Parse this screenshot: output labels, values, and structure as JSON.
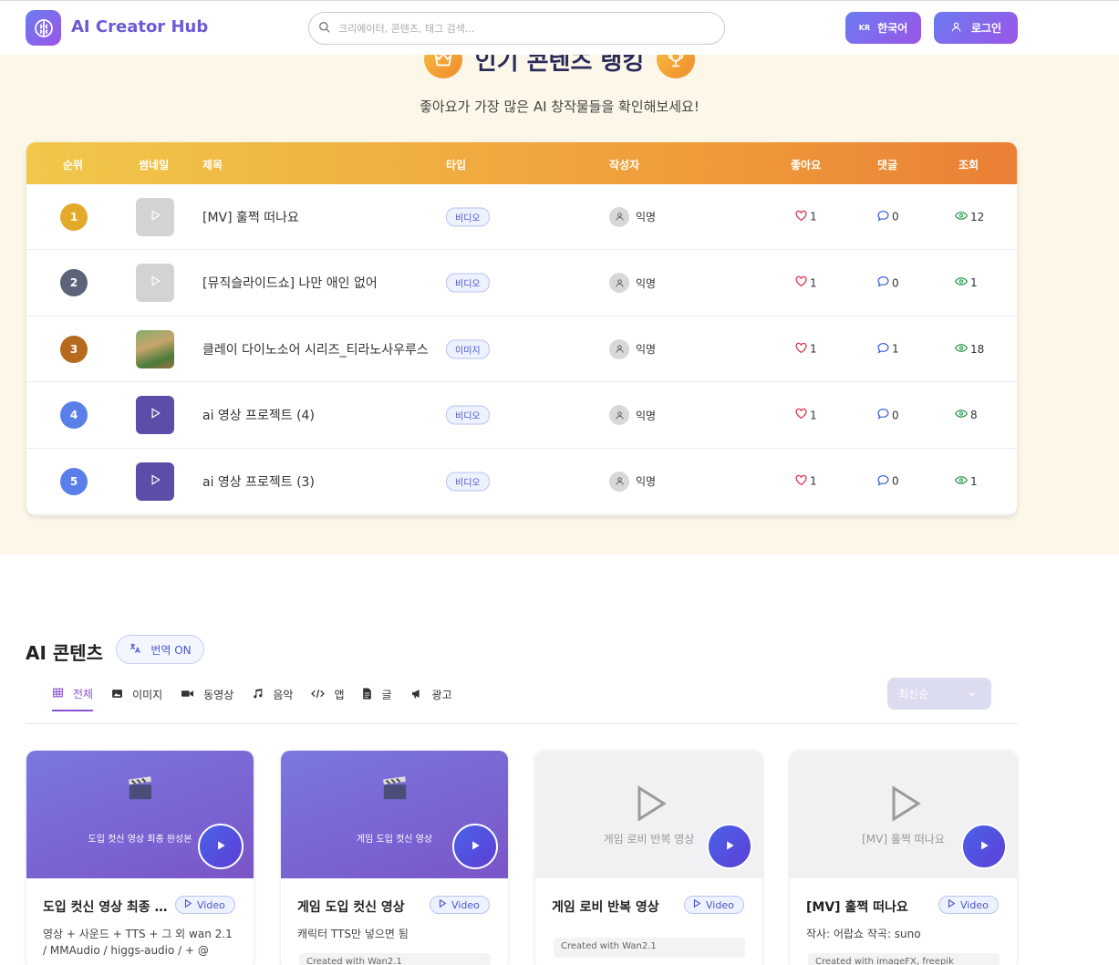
{
  "header": {
    "app_title": "AI Creator Hub",
    "search_placeholder": "크리에이터, 콘텐츠, 태그 검색...",
    "lang_code": "KR",
    "lang_label": "한국어",
    "login_label": "로그인"
  },
  "ranking": {
    "title": "인기 콘텐츠 랭킹",
    "subtitle": "좋아요가 가장 많은 AI 창작물들을 확인해보세요!",
    "columns": [
      "순위",
      "썸네일",
      "제목",
      "타입",
      "작성자",
      "좋아요",
      "댓글",
      "조회"
    ],
    "rows": [
      {
        "rank": "1",
        "badge_color": "#e3a92a",
        "thumb": "gray",
        "title": "[MV] 훌쩍 떠나요",
        "type": "비디오",
        "author": "익명",
        "likes": "1",
        "comments": "0",
        "views": "12"
      },
      {
        "rank": "2",
        "badge_color": "#5b6478",
        "thumb": "gray",
        "title": "[뮤직슬라이드쇼] 나만 애인 없어",
        "type": "비디오",
        "author": "익명",
        "likes": "1",
        "comments": "0",
        "views": "1"
      },
      {
        "rank": "3",
        "badge_color": "#b66a1e",
        "thumb": "img",
        "title": "클레이 다이노소어 시리즈_티라노사우루스",
        "type": "이미지",
        "author": "익명",
        "likes": "1",
        "comments": "1",
        "views": "18"
      },
      {
        "rank": "4",
        "badge_color": "#5b7fea",
        "thumb": "purple",
        "title": "ai 영상 프로젝트 (4)",
        "type": "비디오",
        "author": "익명",
        "likes": "1",
        "comments": "0",
        "views": "8"
      },
      {
        "rank": "5",
        "badge_color": "#5b7fea",
        "thumb": "purple",
        "title": "ai 영상 프로젝트 (3)",
        "type": "비디오",
        "author": "익명",
        "likes": "1",
        "comments": "0",
        "views": "1"
      }
    ]
  },
  "content": {
    "title": "AI 콘텐츠",
    "translate_label": "번역 ON",
    "tabs": [
      {
        "label": "전체",
        "icon": "grid-icon"
      },
      {
        "label": "이미지",
        "icon": "image-icon"
      },
      {
        "label": "동영상",
        "icon": "video-icon"
      },
      {
        "label": "음악",
        "icon": "music-icon"
      },
      {
        "label": "앱",
        "icon": "code-icon"
      },
      {
        "label": "글",
        "icon": "document-icon"
      },
      {
        "label": "광고",
        "icon": "megaphone-icon"
      }
    ],
    "sort_label": "최신순",
    "cards": [
      {
        "caption": "도입 컷신 영상 최종 완성본",
        "title": "도입 컷신 영상 최종 완성본",
        "type": "Video",
        "desc": "영상 + 사운드 + TTS + 그 외 wan 2.1 / MMAudio / higgs-audio / + @",
        "created": ""
      },
      {
        "caption": "게임 도입 컷신 영상",
        "title": "게임 도입 컷신 영상",
        "type": "Video",
        "desc": "캐릭터 TTS만 넣으면 됨",
        "created": "Created with Wan2.1"
      },
      {
        "caption": "게임 로비 반복 영상",
        "title": "게임 로비 반복 영상",
        "type": "Video",
        "desc": "",
        "created": "Created with Wan2.1"
      },
      {
        "caption": "[MV] 훌쩍 떠나요",
        "title": "[MV] 훌쩍 떠나요",
        "type": "Video",
        "desc": "작사: 어랍쇼 작곡: suno",
        "created": "Created with imageFX, freepik"
      }
    ]
  }
}
